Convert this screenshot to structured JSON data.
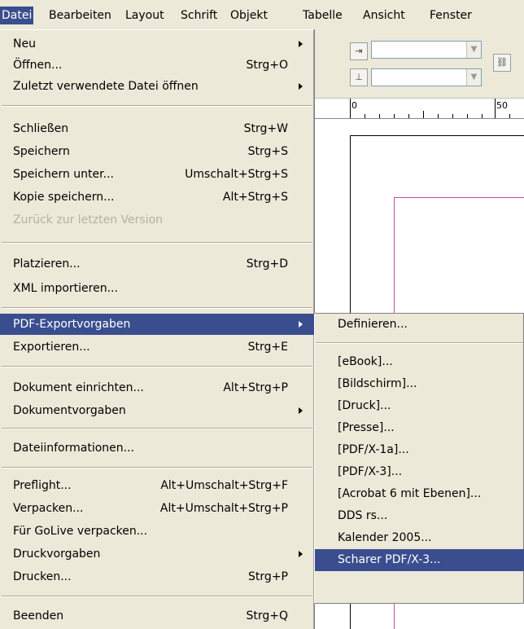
{
  "menubar": {
    "items": [
      "Datei",
      "Bearbeiten",
      "Layout",
      "Schrift",
      "Objekt",
      "Tabelle",
      "Ansicht",
      "Fenster"
    ]
  },
  "ruler": {
    "labels": [
      "0",
      "50"
    ]
  },
  "file_menu": {
    "groups": [
      [
        {
          "label": "Neu",
          "shortcut": "",
          "submenu": true
        },
        {
          "label": "Öffnen...",
          "shortcut": "Strg+O",
          "submenu": false
        },
        {
          "label": "Zuletzt verwendete Datei öffnen",
          "shortcut": "",
          "submenu": true
        }
      ],
      [
        {
          "label": "Schließen",
          "shortcut": "Strg+W",
          "submenu": false
        },
        {
          "label": "Speichern",
          "shortcut": "Strg+S",
          "submenu": false
        },
        {
          "label": "Speichern unter...",
          "shortcut": "Umschalt+Strg+S",
          "submenu": false
        },
        {
          "label": "Kopie speichern...",
          "shortcut": "Alt+Strg+S",
          "submenu": false
        },
        {
          "label": "Zurück zur letzten Version",
          "shortcut": "",
          "submenu": false,
          "disabled": true
        }
      ],
      [
        {
          "label": "Platzieren...",
          "shortcut": "Strg+D",
          "submenu": false
        },
        {
          "label": "XML importieren...",
          "shortcut": "",
          "submenu": false
        }
      ],
      [
        {
          "label": "PDF-Exportvorgaben",
          "shortcut": "",
          "submenu": true,
          "highlighted": true
        },
        {
          "label": "Exportieren...",
          "shortcut": "Strg+E",
          "submenu": false
        }
      ],
      [
        {
          "label": "Dokument einrichten...",
          "shortcut": "Alt+Strg+P",
          "submenu": false
        },
        {
          "label": "Dokumentvorgaben",
          "shortcut": "",
          "submenu": true
        }
      ],
      [
        {
          "label": "Dateiinformationen...",
          "shortcut": "",
          "submenu": false
        }
      ],
      [
        {
          "label": "Preflight...",
          "shortcut": "Alt+Umschalt+Strg+F",
          "submenu": false
        },
        {
          "label": "Verpacken...",
          "shortcut": "Alt+Umschalt+Strg+P",
          "submenu": false
        },
        {
          "label": "Für GoLive verpacken...",
          "shortcut": "",
          "submenu": false
        },
        {
          "label": "Druckvorgaben",
          "shortcut": "",
          "submenu": true
        },
        {
          "label": "Drucken...",
          "shortcut": "Strg+P",
          "submenu": false
        }
      ],
      [
        {
          "label": "Beenden",
          "shortcut": "Strg+Q",
          "submenu": false
        }
      ]
    ]
  },
  "pdf_submenu": {
    "items": [
      {
        "label": "Definieren..."
      },
      {
        "label": "[eBook]..."
      },
      {
        "label": "[Bildschirm]..."
      },
      {
        "label": "[Druck]..."
      },
      {
        "label": "[Presse]..."
      },
      {
        "label": "[PDF/X-1a]..."
      },
      {
        "label": "[PDF/X-3]..."
      },
      {
        "label": "[Acrobat 6 mit Ebenen]..."
      },
      {
        "label": "DDS rs..."
      },
      {
        "label": "Kalender 2005..."
      },
      {
        "label": "Scharer PDF/X-3...",
        "highlighted": true
      }
    ]
  },
  "colors": {
    "menu_bg": "#ece9d8",
    "highlight": "#3a4e8f",
    "disabled_text": "#b4b1a6",
    "margin_guide": "#c050a0"
  }
}
